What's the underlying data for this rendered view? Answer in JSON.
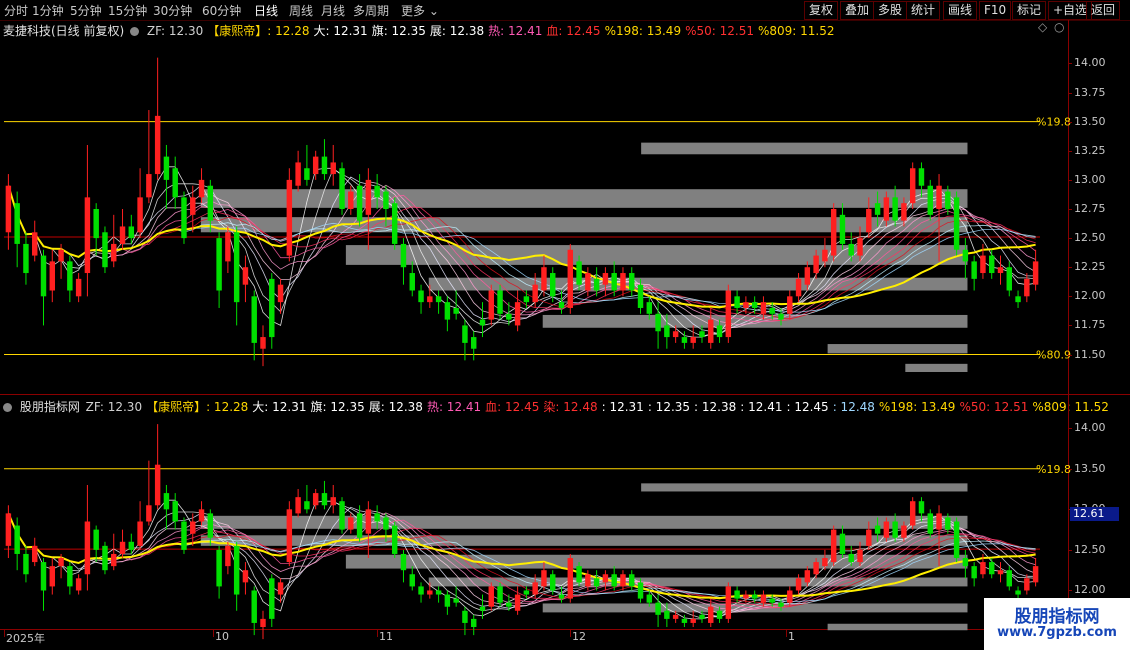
{
  "toolbar": {
    "timeframes": [
      "分时",
      "1分钟",
      "5分钟",
      "15分钟",
      "30分钟",
      "60分钟",
      "日线",
      "周线",
      "月线",
      "多周期",
      "更多"
    ],
    "active_timeframe": "日线",
    "buttons": [
      "复权",
      "叠加",
      "多股",
      "统计",
      "画线",
      "F10",
      "标记",
      "+自选",
      "返回"
    ]
  },
  "panel1": {
    "title": "麦捷科技(日线 前复权)",
    "values": [
      {
        "t": "ZF: 12.30",
        "c": "#d0d0d0"
      },
      {
        "t": "【康熙帝】: 12.28",
        "c": "#ffd700"
      },
      {
        "t": "大: 12.31",
        "c": "#ffffff"
      },
      {
        "t": "旗: 12.35",
        "c": "#ffffff"
      },
      {
        "t": "展: 12.38",
        "c": "#ffffff"
      },
      {
        "t": "热: 12.41",
        "c": "#ff5ab4"
      },
      {
        "t": "血: 12.45",
        "c": "#ff3030"
      },
      {
        "t": "%198: 13.49",
        "c": "#ffd700"
      },
      {
        "t": "%50: 12.51",
        "c": "#ff3030"
      },
      {
        "t": "%809: 11.52",
        "c": "#ffd700"
      }
    ],
    "y_ticks": [
      "14.00",
      "13.75",
      "13.50",
      "13.25",
      "13.00",
      "12.75",
      "12.50",
      "12.25",
      "12.00",
      "11.75",
      "11.50"
    ],
    "line_labels": [
      "%19.8",
      "%80.9"
    ]
  },
  "panel2": {
    "title": "股朋指标网",
    "values": [
      {
        "t": "ZF: 12.30",
        "c": "#d0d0d0"
      },
      {
        "t": "【康熙帝】: 12.28",
        "c": "#ffd700"
      },
      {
        "t": "大: 12.31",
        "c": "#ffffff"
      },
      {
        "t": "旗: 12.35",
        "c": "#ffffff"
      },
      {
        "t": "展: 12.38",
        "c": "#ffffff"
      },
      {
        "t": "热: 12.41",
        "c": "#ff5ab4"
      },
      {
        "t": "血: 12.45",
        "c": "#ff3030"
      },
      {
        "t": "染: 12.48",
        "c": "#ff3030"
      },
      {
        "t": ": 12.31",
        "c": "#ffffff"
      },
      {
        "t": ": 12.35",
        "c": "#ffffff"
      },
      {
        "t": ": 12.38",
        "c": "#ffffff"
      },
      {
        "t": ": 12.41",
        "c": "#ffffff"
      },
      {
        "t": ": 12.45",
        "c": "#ffffff"
      },
      {
        "t": ": 12.48",
        "c": "#9fd8ff"
      },
      {
        "t": "%198: 13.49",
        "c": "#ffd700"
      },
      {
        "t": "%50: 12.51",
        "c": "#ff3030"
      },
      {
        "t": "%809: 11.52",
        "c": "#ffd700"
      }
    ],
    "y_ticks": [
      "14.00",
      "13.50",
      "13.00",
      "12.50",
      "12.00"
    ],
    "line_labels": [
      "%19.8",
      "%80.9"
    ],
    "current_price": "12.61"
  },
  "xaxis": {
    "labels": [
      "2025年",
      "10",
      "11",
      "12",
      "1"
    ]
  },
  "watermark": {
    "title": "股朋指标网",
    "url": "www.7gpzb.com"
  },
  "chart_data": {
    "type": "candlestick",
    "y_range_top_panel": [
      11.35,
      14.15
    ],
    "y_range_bottom_panel": [
      11.55,
      14.15
    ],
    "horizontal_levels": {
      "%19.8": 13.5,
      "%80.9": 11.5,
      "%50": 12.51
    },
    "candles": [
      {
        "o": 12.55,
        "c": 12.95,
        "h": 13.05,
        "l": 12.4
      },
      {
        "o": 12.8,
        "c": 12.45,
        "h": 12.9,
        "l": 12.25
      },
      {
        "o": 12.45,
        "c": 12.2,
        "h": 12.55,
        "l": 12.1
      },
      {
        "o": 12.35,
        "c": 12.55,
        "h": 12.65,
        "l": 12.3
      },
      {
        "o": 12.35,
        "c": 12.0,
        "h": 12.4,
        "l": 11.75
      },
      {
        "o": 12.05,
        "c": 12.3,
        "h": 12.4,
        "l": 11.95
      },
      {
        "o": 12.3,
        "c": 12.4,
        "h": 12.45,
        "l": 12.15
      },
      {
        "o": 12.3,
        "c": 12.05,
        "h": 12.35,
        "l": 11.95
      },
      {
        "o": 12.0,
        "c": 12.15,
        "h": 12.2,
        "l": 11.95
      },
      {
        "o": 12.2,
        "c": 12.85,
        "h": 13.3,
        "l": 12.0
      },
      {
        "o": 12.75,
        "c": 12.5,
        "h": 12.8,
        "l": 12.35
      },
      {
        "o": 12.55,
        "c": 12.25,
        "h": 12.6,
        "l": 12.2
      },
      {
        "o": 12.3,
        "c": 12.45,
        "h": 12.7,
        "l": 12.25
      },
      {
        "o": 12.45,
        "c": 12.6,
        "h": 12.75,
        "l": 12.4
      },
      {
        "o": 12.6,
        "c": 12.5,
        "h": 12.7,
        "l": 12.45
      },
      {
        "o": 12.55,
        "c": 12.85,
        "h": 13.1,
        "l": 12.5
      },
      {
        "o": 12.85,
        "c": 13.05,
        "h": 13.6,
        "l": 12.8
      },
      {
        "o": 13.05,
        "c": 13.55,
        "h": 14.05,
        "l": 13.0
      },
      {
        "o": 13.2,
        "c": 13.0,
        "h": 13.3,
        "l": 12.75
      },
      {
        "o": 13.1,
        "c": 12.85,
        "h": 13.2,
        "l": 12.75
      },
      {
        "o": 12.85,
        "c": 12.5,
        "h": 12.9,
        "l": 12.45
      },
      {
        "o": 12.7,
        "c": 12.85,
        "h": 12.95,
        "l": 12.55
      },
      {
        "o": 12.85,
        "c": 13.0,
        "h": 13.1,
        "l": 12.8
      },
      {
        "o": 12.95,
        "c": 12.65,
        "h": 13.0,
        "l": 12.55
      },
      {
        "o": 12.5,
        "c": 12.05,
        "h": 12.55,
        "l": 11.9
      },
      {
        "o": 12.3,
        "c": 12.55,
        "h": 12.6,
        "l": 12.2
      },
      {
        "o": 12.55,
        "c": 11.95,
        "h": 12.6,
        "l": 11.75
      },
      {
        "o": 12.1,
        "c": 12.25,
        "h": 12.35,
        "l": 11.95
      },
      {
        "o": 12.0,
        "c": 11.6,
        "h": 12.05,
        "l": 11.45
      },
      {
        "o": 11.55,
        "c": 11.65,
        "h": 11.75,
        "l": 11.4
      },
      {
        "o": 12.15,
        "c": 11.65,
        "h": 12.2,
        "l": 11.55
      },
      {
        "o": 11.95,
        "c": 12.1,
        "h": 12.15,
        "l": 11.85
      },
      {
        "o": 12.35,
        "c": 13.0,
        "h": 13.1,
        "l": 12.3
      },
      {
        "o": 12.95,
        "c": 13.15,
        "h": 13.25,
        "l": 12.9
      },
      {
        "o": 13.1,
        "c": 13.0,
        "h": 13.3,
        "l": 12.95
      },
      {
        "o": 13.05,
        "c": 13.2,
        "h": 13.25,
        "l": 13.0
      },
      {
        "o": 13.2,
        "c": 13.05,
        "h": 13.35,
        "l": 13.0
      },
      {
        "o": 13.05,
        "c": 13.15,
        "h": 13.3,
        "l": 12.95
      },
      {
        "o": 13.1,
        "c": 12.75,
        "h": 13.15,
        "l": 12.7
      },
      {
        "o": 12.75,
        "c": 12.9,
        "h": 12.95,
        "l": 12.7
      },
      {
        "o": 12.95,
        "c": 12.65,
        "h": 13.05,
        "l": 12.6
      },
      {
        "o": 12.7,
        "c": 13.0,
        "h": 13.1,
        "l": 12.4
      },
      {
        "o": 12.95,
        "c": 12.85,
        "h": 13.05,
        "l": 12.75
      },
      {
        "o": 12.9,
        "c": 12.75,
        "h": 12.95,
        "l": 12.6
      },
      {
        "o": 12.8,
        "c": 12.45,
        "h": 12.85,
        "l": 12.4
      },
      {
        "o": 12.45,
        "c": 12.25,
        "h": 12.5,
        "l": 12.1
      },
      {
        "o": 12.2,
        "c": 12.05,
        "h": 12.3,
        "l": 12.0
      },
      {
        "o": 12.05,
        "c": 11.95,
        "h": 12.1,
        "l": 11.85
      },
      {
        "o": 11.95,
        "c": 12.0,
        "h": 12.1,
        "l": 11.9
      },
      {
        "o": 12.0,
        "c": 11.95,
        "h": 12.05,
        "l": 11.85
      },
      {
        "o": 11.95,
        "c": 11.8,
        "h": 12.0,
        "l": 11.7
      },
      {
        "o": 11.9,
        "c": 11.85,
        "h": 12.05,
        "l": 11.8
      },
      {
        "o": 11.75,
        "c": 11.6,
        "h": 11.8,
        "l": 11.45
      },
      {
        "o": 11.65,
        "c": 11.55,
        "h": 11.7,
        "l": 11.45
      },
      {
        "o": 11.8,
        "c": 11.75,
        "h": 11.95,
        "l": 11.65
      },
      {
        "o": 11.8,
        "c": 12.05,
        "h": 12.1,
        "l": 11.75
      },
      {
        "o": 12.05,
        "c": 11.85,
        "h": 12.1,
        "l": 11.8
      },
      {
        "o": 11.85,
        "c": 11.8,
        "h": 11.95,
        "l": 11.75
      },
      {
        "o": 11.75,
        "c": 11.95,
        "h": 12.05,
        "l": 11.7
      },
      {
        "o": 12.0,
        "c": 11.95,
        "h": 12.05,
        "l": 11.9
      },
      {
        "o": 11.95,
        "c": 12.1,
        "h": 12.2,
        "l": 11.9
      },
      {
        "o": 12.05,
        "c": 12.25,
        "h": 12.35,
        "l": 12.0
      },
      {
        "o": 12.2,
        "c": 12.0,
        "h": 12.25,
        "l": 11.95
      },
      {
        "o": 11.95,
        "c": 11.9,
        "h": 12.05,
        "l": 11.85
      },
      {
        "o": 11.9,
        "c": 12.4,
        "h": 12.45,
        "l": 11.85
      },
      {
        "o": 12.3,
        "c": 12.1,
        "h": 12.35,
        "l": 12.05
      },
      {
        "o": 12.05,
        "c": 12.2,
        "h": 12.25,
        "l": 12.0
      },
      {
        "o": 12.15,
        "c": 12.05,
        "h": 12.25,
        "l": 12.0
      },
      {
        "o": 12.1,
        "c": 12.2,
        "h": 12.25,
        "l": 12.0
      },
      {
        "o": 12.2,
        "c": 12.05,
        "h": 12.3,
        "l": 12.0
      },
      {
        "o": 12.05,
        "c": 12.2,
        "h": 12.25,
        "l": 12.0
      },
      {
        "o": 12.2,
        "c": 12.05,
        "h": 12.25,
        "l": 12.0
      },
      {
        "o": 12.1,
        "c": 11.9,
        "h": 12.15,
        "l": 11.85
      },
      {
        "o": 11.95,
        "c": 11.85,
        "h": 12.0,
        "l": 11.8
      },
      {
        "o": 11.85,
        "c": 11.7,
        "h": 11.95,
        "l": 11.55
      },
      {
        "o": 11.75,
        "c": 11.65,
        "h": 11.85,
        "l": 11.55
      },
      {
        "o": 11.65,
        "c": 11.7,
        "h": 11.75,
        "l": 11.6
      },
      {
        "o": 11.65,
        "c": 11.6,
        "h": 11.7,
        "l": 11.55
      },
      {
        "o": 11.6,
        "c": 11.65,
        "h": 11.75,
        "l": 11.55
      },
      {
        "o": 11.7,
        "c": 11.65,
        "h": 11.75,
        "l": 11.6
      },
      {
        "o": 11.6,
        "c": 11.8,
        "h": 11.9,
        "l": 11.55
      },
      {
        "o": 11.75,
        "c": 11.65,
        "h": 11.8,
        "l": 11.6
      },
      {
        "o": 11.65,
        "c": 12.05,
        "h": 12.1,
        "l": 11.6
      },
      {
        "o": 12.0,
        "c": 11.9,
        "h": 12.05,
        "l": 11.85
      },
      {
        "o": 11.9,
        "c": 11.95,
        "h": 12.0,
        "l": 11.85
      },
      {
        "o": 11.95,
        "c": 11.9,
        "h": 12.0,
        "l": 11.85
      },
      {
        "o": 11.85,
        "c": 11.95,
        "h": 12.0,
        "l": 11.8
      },
      {
        "o": 11.9,
        "c": 11.85,
        "h": 11.95,
        "l": 11.8
      },
      {
        "o": 11.85,
        "c": 11.8,
        "h": 11.9,
        "l": 11.75
      },
      {
        "o": 11.85,
        "c": 12.0,
        "h": 12.05,
        "l": 11.8
      },
      {
        "o": 12.0,
        "c": 12.15,
        "h": 12.2,
        "l": 11.95
      },
      {
        "o": 12.1,
        "c": 12.25,
        "h": 12.3,
        "l": 12.05
      },
      {
        "o": 12.2,
        "c": 12.35,
        "h": 12.4,
        "l": 12.15
      },
      {
        "o": 12.3,
        "c": 12.4,
        "h": 12.5,
        "l": 12.25
      },
      {
        "o": 12.35,
        "c": 12.75,
        "h": 12.8,
        "l": 12.3
      },
      {
        "o": 12.7,
        "c": 12.45,
        "h": 12.8,
        "l": 12.4
      },
      {
        "o": 12.45,
        "c": 12.35,
        "h": 12.55,
        "l": 12.3
      },
      {
        "o": 12.35,
        "c": 12.5,
        "h": 12.6,
        "l": 12.3
      },
      {
        "o": 12.55,
        "c": 12.75,
        "h": 12.85,
        "l": 12.5
      },
      {
        "o": 12.8,
        "c": 12.7,
        "h": 12.9,
        "l": 12.6
      },
      {
        "o": 12.65,
        "c": 12.85,
        "h": 12.9,
        "l": 12.6
      },
      {
        "o": 12.85,
        "c": 12.65,
        "h": 12.95,
        "l": 12.6
      },
      {
        "o": 12.65,
        "c": 12.8,
        "h": 12.85,
        "l": 12.6
      },
      {
        "o": 12.8,
        "c": 13.1,
        "h": 13.15,
        "l": 12.75
      },
      {
        "o": 13.1,
        "c": 12.95,
        "h": 13.15,
        "l": 12.85
      },
      {
        "o": 12.95,
        "c": 12.7,
        "h": 13.0,
        "l": 12.65
      },
      {
        "o": 12.75,
        "c": 12.95,
        "h": 13.05,
        "l": 12.3
      },
      {
        "o": 12.9,
        "c": 12.75,
        "h": 12.95,
        "l": 12.7
      },
      {
        "o": 12.85,
        "c": 12.4,
        "h": 12.9,
        "l": 12.35
      },
      {
        "o": 12.4,
        "c": 12.3,
        "h": 12.5,
        "l": 12.15
      },
      {
        "o": 12.3,
        "c": 12.15,
        "h": 12.35,
        "l": 12.05
      },
      {
        "o": 12.2,
        "c": 12.35,
        "h": 12.45,
        "l": 12.15
      },
      {
        "o": 12.35,
        "c": 12.2,
        "h": 12.4,
        "l": 12.15
      },
      {
        "o": 12.2,
        "c": 12.25,
        "h": 12.35,
        "l": 12.1
      },
      {
        "o": 12.25,
        "c": 12.05,
        "h": 12.3,
        "l": 12.0
      },
      {
        "o": 12.0,
        "c": 11.95,
        "h": 12.05,
        "l": 11.9
      },
      {
        "o": 12.0,
        "c": 12.15,
        "h": 12.2,
        "l": 11.95
      },
      {
        "o": 12.1,
        "c": 12.3,
        "h": 12.4,
        "l": 12.05
      }
    ],
    "zones": [
      {
        "x0": 0.19,
        "x1": 0.93,
        "y0": 12.92,
        "y1": 12.76
      },
      {
        "x0": 0.19,
        "x1": 0.93,
        "y0": 12.68,
        "y1": 12.55
      },
      {
        "x0": 0.33,
        "x1": 0.93,
        "y0": 12.44,
        "y1": 12.27
      },
      {
        "x0": 0.41,
        "x1": 0.93,
        "y0": 12.16,
        "y1": 12.05
      },
      {
        "x0": 0.52,
        "x1": 0.93,
        "y0": 11.84,
        "y1": 11.73
      },
      {
        "x0": 0.615,
        "x1": 0.93,
        "y0": 13.32,
        "y1": 13.22
      },
      {
        "x0": 0.795,
        "x1": 0.93,
        "y0": 11.59,
        "y1": 11.51
      },
      {
        "x0": 0.87,
        "x1": 0.93,
        "y0": 11.42,
        "y1": 11.35
      }
    ]
  }
}
